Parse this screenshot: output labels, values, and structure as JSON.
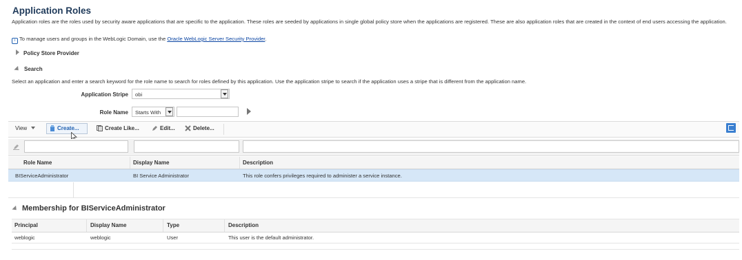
{
  "page": {
    "title": "Application Roles",
    "description": "Application roles are the roles used by security aware applications that are specific to the application. These roles are seeded by applications in single global policy store when the applications are registered. These are also application roles that are created in the context of end users accessing the application.",
    "manage_prefix": "To manage users and groups in the WebLogic Domain, use the",
    "manage_link": "Oracle WebLogic Server Security Provider",
    "manage_suffix": "."
  },
  "policy_store": {
    "label": "Policy Store Provider"
  },
  "search": {
    "label": "Search",
    "description": "Select an application and enter a search keyword for the role name to search for roles defined by this application. Use the application stripe to search if the application uses a stripe that is different from the application name.",
    "stripe_label": "Application Stripe",
    "stripe_value": "obi",
    "role_name_label": "Role Name",
    "role_name_operator": "Starts With",
    "role_name_value": ""
  },
  "toolbar": {
    "view_label": "View",
    "create_label": "Create...",
    "create_like_label": "Create Like...",
    "edit_label": "Edit...",
    "delete_label": "Delete..."
  },
  "roles_table": {
    "columns": [
      "Role Name",
      "Display Name",
      "Description"
    ],
    "rows": [
      [
        "BIServiceAdministrator",
        "BI Service Administrator",
        "This role confers privileges required to administer a service instance."
      ]
    ]
  },
  "membership": {
    "title": "Membership for BIServiceAdministrator",
    "columns": [
      "Principal",
      "Display Name",
      "Type",
      "Description"
    ],
    "rows": [
      [
        "weblogic",
        "weblogic",
        "User",
        "This user is the default administrator."
      ]
    ]
  },
  "colors": {
    "title": "#1f3a5a",
    "link": "#0b45a3",
    "selected_row": "#d6e7f7",
    "accent_button": "#3a7fd0"
  },
  "icons": [
    "info-icon",
    "expand-triangle-icon",
    "collapse-triangle-icon",
    "dropdown-arrow-icon",
    "go-arrow-icon",
    "create-icon",
    "create-like-icon",
    "edit-pencil-icon",
    "delete-x-icon",
    "filter-clear-icon",
    "export-icon",
    "mouse-cursor-icon"
  ]
}
